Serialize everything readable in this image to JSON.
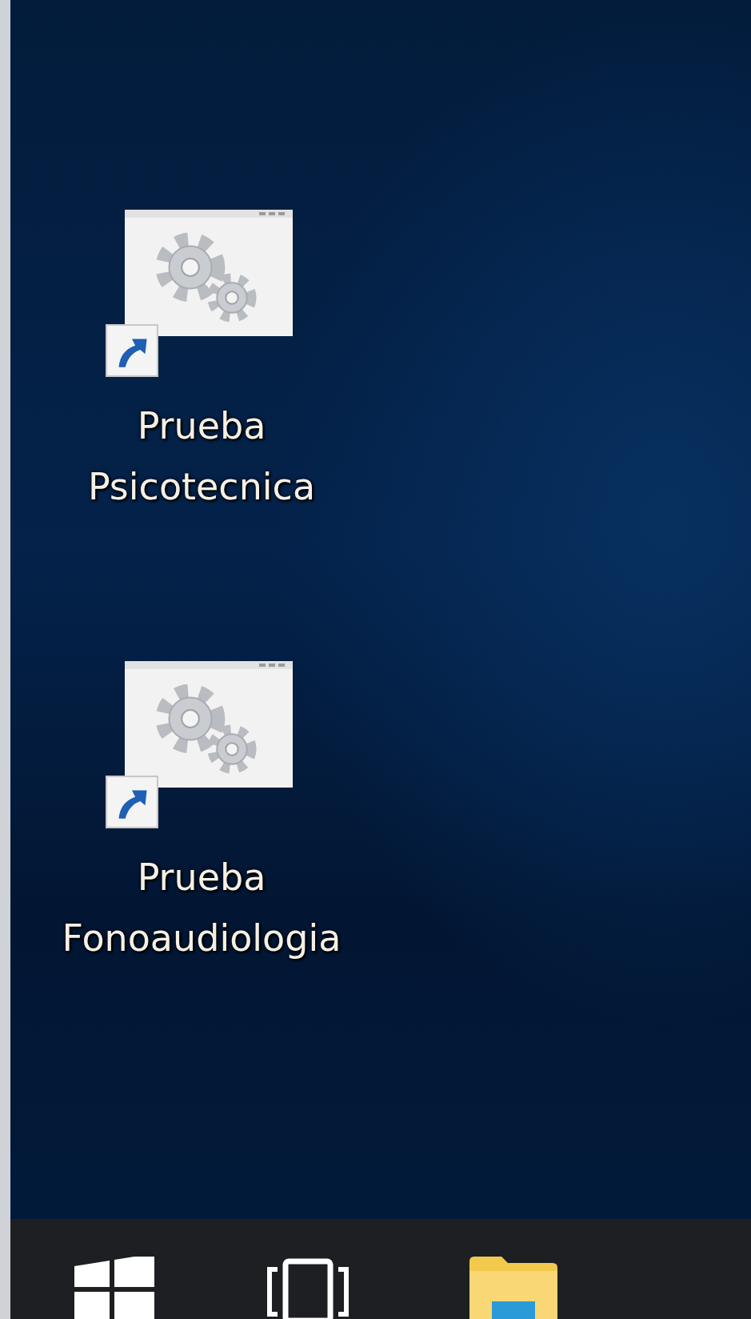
{
  "desktop": {
    "icons": [
      {
        "label": "Prueba Psicotecnica"
      },
      {
        "label": "Prueba Fonoaudiologia"
      }
    ]
  }
}
